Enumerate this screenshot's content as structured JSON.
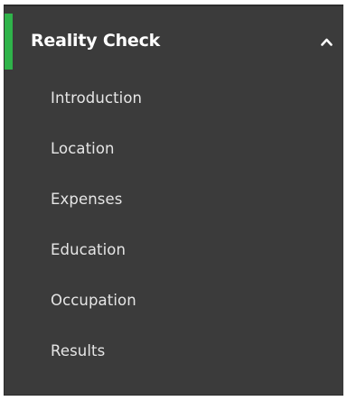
{
  "section": {
    "title": "Reality Check",
    "accent_color": "#2fb34a",
    "toggle_icon": "chevron-up-icon",
    "expanded": true
  },
  "menu": {
    "items": [
      {
        "label": "Introduction"
      },
      {
        "label": "Location"
      },
      {
        "label": "Expenses"
      },
      {
        "label": "Education"
      },
      {
        "label": "Occupation"
      },
      {
        "label": "Results"
      }
    ]
  }
}
